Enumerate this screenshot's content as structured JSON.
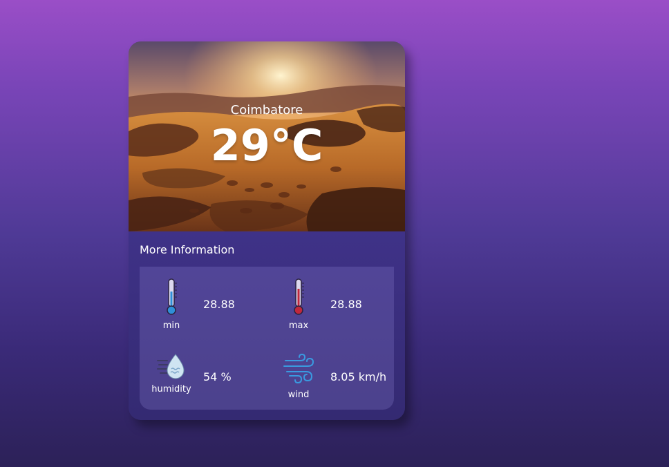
{
  "weather": {
    "city": "Coimbatore",
    "temperature": "29°C"
  },
  "more_info": {
    "title": "More Information",
    "items": [
      {
        "label": "min",
        "value": "28.88",
        "icon": "thermometer-cold-icon"
      },
      {
        "label": "max",
        "value": "28.88",
        "icon": "thermometer-hot-icon"
      },
      {
        "label": "humidity",
        "value": "54 %",
        "icon": "humidity-drop-icon"
      },
      {
        "label": "wind",
        "value": "8.05 km/h",
        "icon": "wind-icon"
      }
    ]
  },
  "colors": {
    "background_top": "#9a4ec7",
    "background_bottom": "#2c2158",
    "card": "#3f3288",
    "cold_accent": "#2f8fd8",
    "hot_accent": "#c0283c",
    "wind_accent": "#3a9ae0"
  }
}
